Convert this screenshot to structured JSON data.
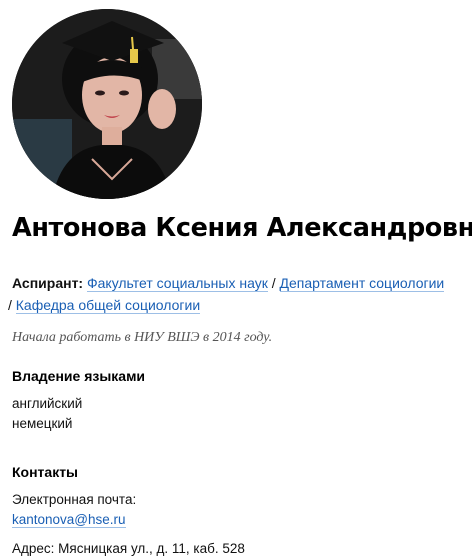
{
  "profile": {
    "name": "Антонова Ксения Александровна",
    "avatar_icon": "person-photo",
    "position": {
      "role_label": "Аспирант:",
      "links": [
        "Факультет социальных наук",
        "Департамент социологии",
        "Кафедра общей социологии"
      ],
      "separator": " / "
    },
    "since": "Начала работать в НИУ ВШЭ в 2014 году."
  },
  "languages": {
    "heading": "Владение языками",
    "items": [
      "английский",
      "немецкий"
    ]
  },
  "contacts": {
    "heading": "Контакты",
    "email_label": "Электронная почта:",
    "email": "kantonova@hse.ru",
    "address": "Адрес: Мясницкая ул., д. 11, каб. 528"
  },
  "colors": {
    "link": "#1a5fb4",
    "muted": "#555555"
  }
}
